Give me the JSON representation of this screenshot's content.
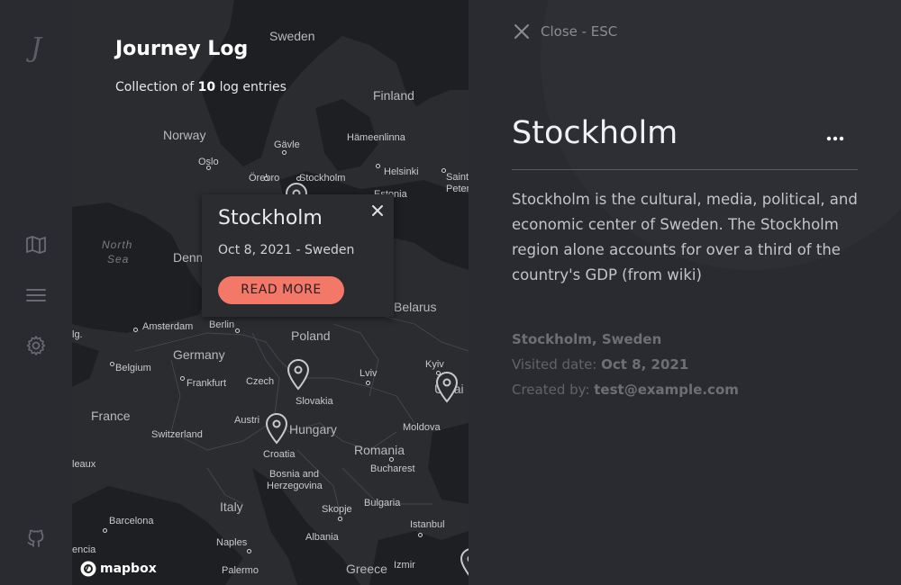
{
  "sidebar": {
    "logo": "J",
    "icons": [
      "map-icon",
      "menu-icon",
      "gear-icon",
      "github-icon"
    ]
  },
  "map": {
    "title": "Journey Log",
    "subtitle_prefix": "Collection of ",
    "subtitle_count": "10",
    "subtitle_suffix": " log entries",
    "labels": {
      "sweden": "Sweden",
      "finland": "Finland",
      "norway": "Norway",
      "gavle": "Gävle",
      "hameenlinna": "Hämeenlinna",
      "oslo": "Oslo",
      "orebro": "Örebro",
      "stockholm": "Stockholm",
      "helsinki": "Helsinki",
      "saint": "Saint",
      "peter": "Peter",
      "estonia": "Estonia",
      "north": "North",
      "sea": "Sea",
      "denm": "Denm",
      "belarus": "Belarus",
      "amsterdam": "Amsterdam",
      "berlin": "Berlin",
      "poland": "Poland",
      "germany": "Germany",
      "belgium": "Belgium",
      "frankfurt": "Frankfurt",
      "czech": "Czech",
      "lviv": "Lviv",
      "kyiv": "Kyiv",
      "ukrai": "Ukrai",
      "slovakia": "Slovakia",
      "france": "France",
      "austria": "Austri",
      "hungary": "Hungary",
      "moldova": "Moldova",
      "switzerland": "Switzerland",
      "romania": "Romania",
      "croatia": "Croatia",
      "bordeaux": "leaux",
      "bosnia": "Bosnia and",
      "herzegovina": "Herzegovina",
      "bucharest": "Bucharest",
      "italy": "Italy",
      "bulgaria": "Bulgaria",
      "skopje": "Skopje",
      "barcelona": "Barcelona",
      "istanbul": "Istanbul",
      "albania": "Albania",
      "naples": "Naples",
      "valencia": "encia",
      "palermo": "Palermo",
      "greece": "Greece",
      "izmir": "Izmir",
      "lg": "lg."
    },
    "popup": {
      "city": "Stockholm",
      "date_country": "Oct 8, 2021 - Sweden",
      "button": "READ MORE"
    },
    "attribution": "mapbox"
  },
  "detail": {
    "close_label": "Close - ESC",
    "title": "Stockholm",
    "description": "Stockholm is the cultural, media, political, and economic center of Sweden. The Stockholm region alone accounts for over a third of the country's GDP (from wiki)",
    "location": "Stockholm, Sweden",
    "visited_label": "Visited date: ",
    "visited_value": "Oct 8, 2021",
    "created_label": "Created by: ",
    "created_value": "test@example.com"
  },
  "colors": {
    "accent": "#f47867",
    "background": "#2a2b30",
    "map_land": "#2b2c30",
    "map_water": "#1d1f22"
  }
}
